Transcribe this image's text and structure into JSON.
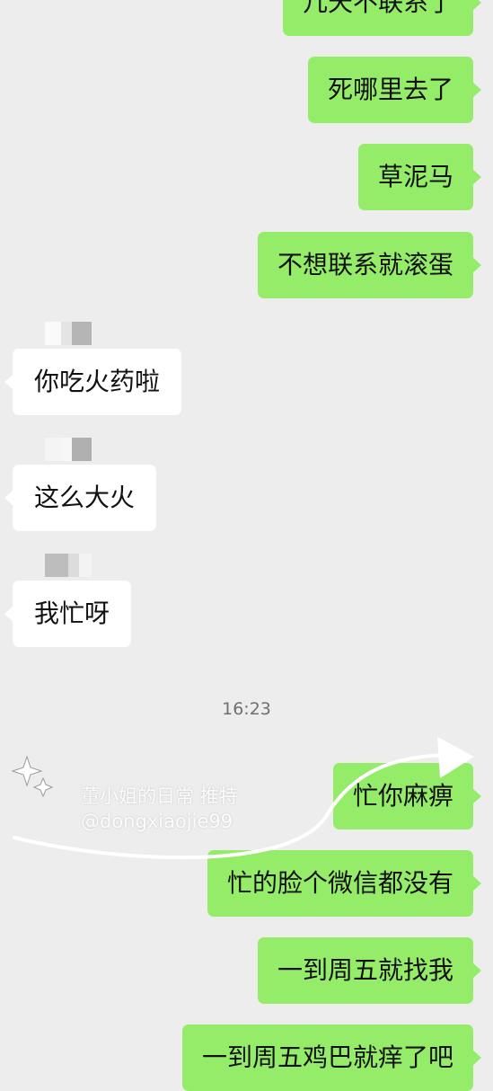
{
  "messages_top": [
    {
      "id": "msg1",
      "text": "几天不联系了"
    },
    {
      "id": "msg2",
      "text": "死哪里去了"
    },
    {
      "id": "msg3",
      "text": "草泥马"
    },
    {
      "id": "msg4",
      "text": "不想联系就滚蛋"
    }
  ],
  "messages_incoming": [
    {
      "id": "msg5",
      "text": "你吃火药啦"
    },
    {
      "id": "msg6",
      "text": "这么大火"
    },
    {
      "id": "msg7",
      "text": "我忙呀"
    }
  ],
  "timestamp": "16:23",
  "messages_bottom": [
    {
      "id": "msg8",
      "text": "忙你麻痹"
    },
    {
      "id": "msg9",
      "text": "忙的脸个微信都没有"
    },
    {
      "id": "msg10",
      "text": "一到周五就找我"
    },
    {
      "id": "msg11",
      "text": "一到周五鸡巴就痒了吧"
    }
  ],
  "watermark": {
    "line1": "董小姐的日常 推特",
    "line2": "@dongxiaojie99"
  },
  "colors": {
    "background": "#ededed",
    "outgoing_bubble": "#95ec69",
    "incoming_bubble": "#ffffff",
    "timestamp_text": "#707070"
  }
}
